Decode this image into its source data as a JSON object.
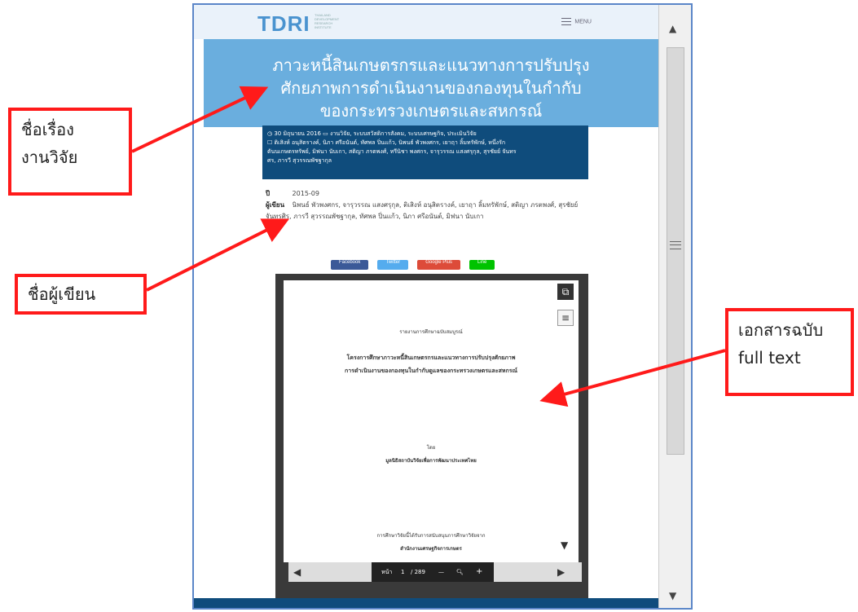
{
  "site": {
    "logo": "TDRI",
    "logo_sub": "THAILAND DEVELOPMENT RESEARCH INSTITUTE",
    "menu_label": "MENU",
    "title_lines": [
      "ภาวะหนี้สินเกษตรกรและแนวทางการปรับปรุง",
      "ศักยภาพการดำเนินงานของกองทุนในกำกับ",
      "ของกระทรวงเกษตรและสหกรณ์"
    ],
    "meta_lines": [
      "◷ 30 มิถุนายน 2016  ▭ งานวิจัย, ระบบสวัสดิการสังคม, ระบบเศรษฐกิจ, ประเมินวิจัย",
      "☐ ติเสิงห์ อนุสิตรางค์, นิภา ศรีอนันต์, ทัศพล ปิ่นแก้ว, นิพนธ์ พัวพงศกร, เยาฤา ลิ้มทรัพักษ์, หนึ่งรัก",
      "ตันนเกษตรทรัพย์, มิฟนา นับเกา, สติญา ภรตพงศ์, ทรีนิชา พงศกร, จารุวรรณ แสงศรุกุล, สุรชัยย์ จันทร",
      "ศร, ภารวี สุวรรณพัชฐากุล"
    ],
    "info": {
      "year_label": "ปี",
      "year": "2015-09",
      "author_label": "ผู้เขียน",
      "authors": "นิพนธ์ พัวพงศกร, จารุวรรณ แสงศรุกุล, ติเสิงห์ อนุสิตรางค์, เยาฤา ลิ้มทรัพักษ์, สติญา ภรตพงศ์, สุรชัยย์ จันทรศิร, ภารวี สุวรรณพัชฐากุล, ทัศพล ปิ่นแก้ว, นิภา ศรีอนันต์, มิฟนา นับเกา"
    },
    "share_buttons": [
      {
        "label": "Facebook",
        "color": "#3b5998"
      },
      {
        "label": "Twitter",
        "color": "#55acee"
      },
      {
        "label": "Google Plus",
        "color": "#dd4b39"
      },
      {
        "label": "Line",
        "color": "#00c300"
      }
    ],
    "document": {
      "line1": "รายงานการศึกษาฉบับสมบูรณ์",
      "line2": "โครงการศึกษาภาวะหนี้สินเกษตรกรและแนวทางการปรับปรุงศักยภาพ",
      "line3": "การดำเนินงานของกองทุนในกำกับดูแลของกระทรวงเกษตรและสหกรณ์",
      "line4": "โดย",
      "line5": "มูลนิธิสถาบันวิจัยเพื่อการพัฒนาประเทศไทย",
      "line6": "การศึกษาวิจัยนี้ได้รับการสนับสนุนการศึกษาวิจัยจาก",
      "line7": "สำนักงานเศรษฐกิจการเกษตร"
    },
    "pager": {
      "page_label": "หน้า",
      "page": "1",
      "total": "/ 289",
      "minus": "—",
      "plus": "+"
    }
  },
  "callouts": {
    "title": [
      "ชื่อเรื่อง",
      "งานวิจัย"
    ],
    "author": "ชื่อผู้เขียน",
    "fulltext": [
      "เอกสารฉบับ",
      "full text"
    ]
  },
  "colors": {
    "callout_border": "#ff1a1a",
    "hero": "#6aaede",
    "meta_bg": "#0f4c7c",
    "window_border": "#5b86c8"
  }
}
